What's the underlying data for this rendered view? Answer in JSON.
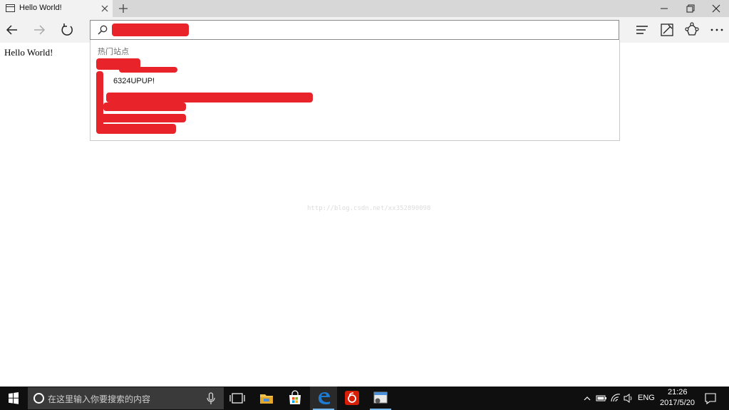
{
  "tab": {
    "title": "Hello World!",
    "close": "×",
    "new": "+"
  },
  "address": {
    "value": "",
    "placeholder": ""
  },
  "page": {
    "text": "Hello World!",
    "watermark": "http://blog.csdn.net/xx352890098"
  },
  "suggestions": {
    "heading": "热门站点",
    "items": [
      "6324UPUP!"
    ]
  },
  "taskbar": {
    "search_placeholder": "在这里输入你要搜索的内容",
    "apps": [
      "task-view",
      "file-explorer",
      "store",
      "edge",
      "netease-music",
      "app-window"
    ],
    "language": "ENG",
    "time": "21:26",
    "date": "2017/5/20"
  },
  "colors": {
    "redaction": "#e8242a",
    "taskbar": "#0f0f0f",
    "edge_blue": "#1e7bd0",
    "accent": "#76b9ed"
  }
}
